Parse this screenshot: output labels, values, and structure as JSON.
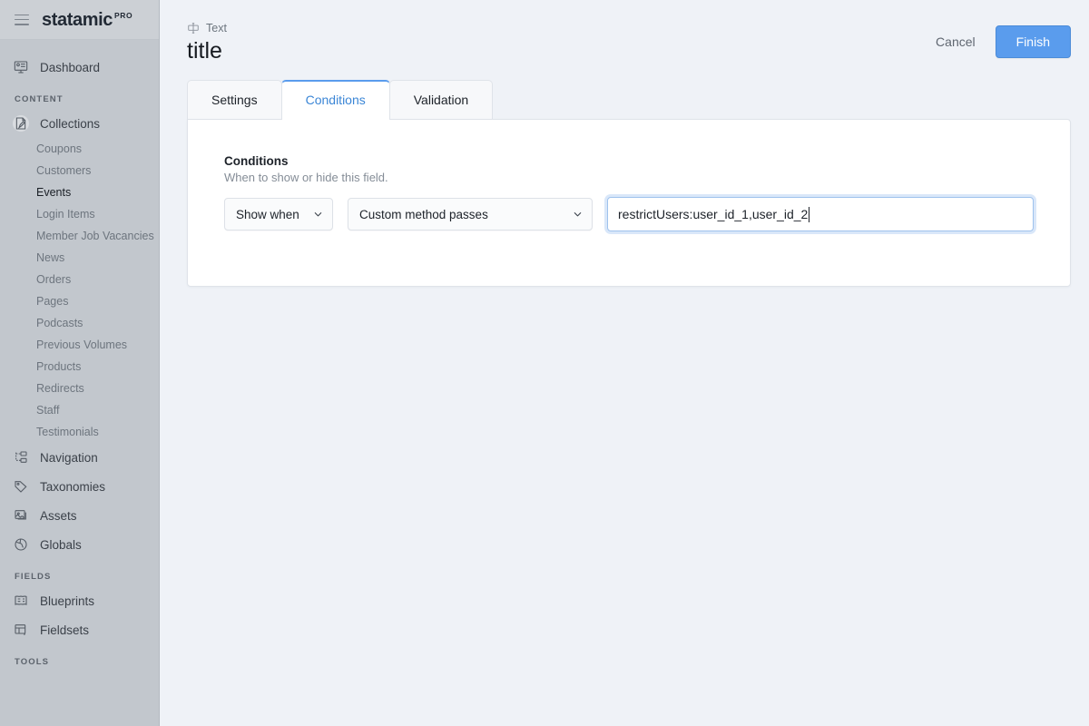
{
  "sidebar": {
    "brand": {
      "name": "statamic",
      "badge": "PRO",
      "menu_icon": "hamburger-icon"
    },
    "primary": [
      {
        "label": "Dashboard",
        "icon": "dashboard-icon"
      }
    ],
    "sections": [
      {
        "title": "CONTENT",
        "items": [
          {
            "label": "Collections",
            "icon": "collections-icon",
            "active": true,
            "children": [
              {
                "label": "Coupons",
                "active": false
              },
              {
                "label": "Customers",
                "active": false
              },
              {
                "label": "Events",
                "active": true
              },
              {
                "label": "Login Items",
                "active": false
              },
              {
                "label": "Member Job Vacancies",
                "active": false
              },
              {
                "label": "News",
                "active": false
              },
              {
                "label": "Orders",
                "active": false
              },
              {
                "label": "Pages",
                "active": false
              },
              {
                "label": "Podcasts",
                "active": false
              },
              {
                "label": "Previous Volumes",
                "active": false
              },
              {
                "label": "Products",
                "active": false
              },
              {
                "label": "Redirects",
                "active": false
              },
              {
                "label": "Staff",
                "active": false
              },
              {
                "label": "Testimonials",
                "active": false
              }
            ]
          },
          {
            "label": "Navigation",
            "icon": "navigation-icon",
            "children": []
          },
          {
            "label": "Taxonomies",
            "icon": "taxonomies-icon",
            "children": []
          },
          {
            "label": "Assets",
            "icon": "assets-icon",
            "children": []
          },
          {
            "label": "Globals",
            "icon": "globals-icon",
            "children": []
          }
        ]
      },
      {
        "title": "FIELDS",
        "items": [
          {
            "label": "Blueprints",
            "icon": "blueprints-icon",
            "children": []
          },
          {
            "label": "Fieldsets",
            "icon": "fieldsets-icon",
            "children": []
          }
        ]
      },
      {
        "title": "TOOLS",
        "items": []
      }
    ]
  },
  "header": {
    "field_type": "Text",
    "field_type_icon": "text-field-icon",
    "title": "title",
    "cancel_label": "Cancel",
    "finish_label": "Finish",
    "accent_color": "#5a9ced"
  },
  "tabs": [
    {
      "label": "Settings",
      "active": false
    },
    {
      "label": "Conditions",
      "active": true
    },
    {
      "label": "Validation",
      "active": false
    }
  ],
  "conditions_panel": {
    "label": "Conditions",
    "help": "When to show or hide this field.",
    "when_select": {
      "value": "Show when",
      "icon": "chevron-down-icon"
    },
    "condition_select": {
      "value": "Custom method passes",
      "icon": "chevron-down-icon"
    },
    "value_input": {
      "value": "restrictUsers:user_id_1,user_id_2",
      "placeholder": "",
      "focused": true
    }
  }
}
